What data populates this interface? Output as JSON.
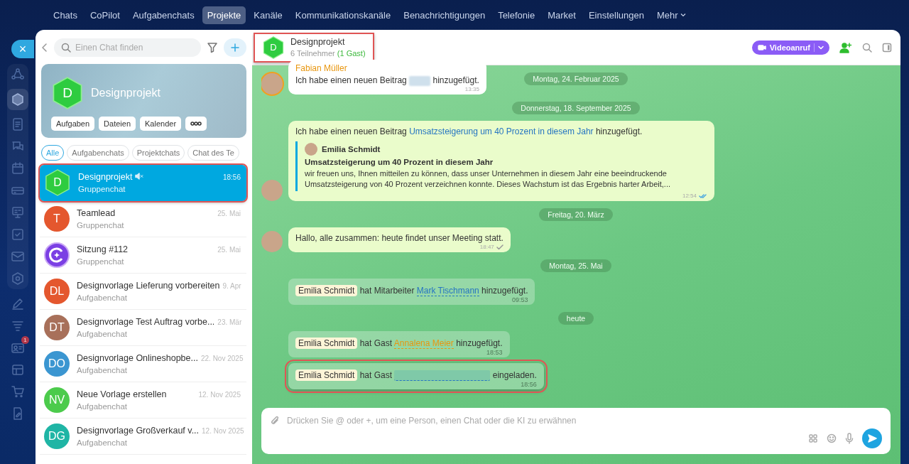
{
  "topnav": {
    "items": [
      {
        "label": "Chats",
        "selected": false
      },
      {
        "label": "CoPilot",
        "selected": false
      },
      {
        "label": "Aufgabenchats",
        "selected": false
      },
      {
        "label": "Projekte",
        "selected": true
      },
      {
        "label": "Kanäle",
        "selected": false
      },
      {
        "label": "Kommunikationskanäle",
        "selected": false
      },
      {
        "label": "Benachrichtigungen",
        "selected": false
      },
      {
        "label": "Telefonie",
        "selected": false
      },
      {
        "label": "Market",
        "selected": false
      },
      {
        "label": "Einstellungen",
        "selected": false
      }
    ],
    "more": "Mehr"
  },
  "rail": {
    "close": "×",
    "badge": "1"
  },
  "sidebar": {
    "search": {
      "placeholder": "Einen Chat finden"
    },
    "project": {
      "initial": "D",
      "title": "Designprojekt",
      "buttons": [
        "Aufgaben",
        "Dateien",
        "Kalender"
      ]
    },
    "filters": [
      {
        "label": "Alle",
        "selected": true
      },
      {
        "label": "Aufgabenchats",
        "selected": false
      },
      {
        "label": "Projektchats",
        "selected": false
      },
      {
        "label": "Chat des Te",
        "selected": false
      }
    ],
    "chats": [
      {
        "kind": "hexagon",
        "initials": "D",
        "color": "#2ecc40",
        "title": "Designprojekt",
        "subtitle": "Gruppenchat",
        "time": "18:56",
        "muted": true,
        "selected": true,
        "highlighted": true
      },
      {
        "kind": "letters",
        "initials": "T",
        "color": "#e4572e",
        "title": "Teamlead",
        "subtitle": "Gruppenchat",
        "time": "25. Mai",
        "muted": false,
        "selected": false,
        "highlighted": false
      },
      {
        "kind": "logo",
        "color": "#7b3fe4",
        "title": "Sitzung #112",
        "subtitle": "Gruppenchat",
        "time": "25. Mai",
        "muted": false,
        "selected": false,
        "highlighted": false
      },
      {
        "kind": "letters",
        "initials": "DL",
        "color": "#e4572e",
        "title": "Designvorlage Lieferung vorbereiten",
        "subtitle": "Aufgabenchat",
        "time": "9. Apr",
        "muted": false,
        "selected": false,
        "highlighted": false
      },
      {
        "kind": "letters",
        "initials": "DT",
        "color": "#a8705a",
        "title": "Designvorlage Test Auftrag vorbe...",
        "subtitle": "Aufgabenchat",
        "time": "23. Mär",
        "muted": false,
        "selected": false,
        "highlighted": false
      },
      {
        "kind": "letters",
        "initials": "DO",
        "color": "#3b96d1",
        "title": "Designvorlage Onlineshopbe...",
        "subtitle": "Aufgabenchat",
        "time": "22. Nov 2025",
        "muted": false,
        "selected": false,
        "highlighted": false
      },
      {
        "kind": "letters",
        "initials": "NV",
        "color": "#4ccb4c",
        "title": "Neue Vorlage erstellen",
        "subtitle": "Aufgabenchat",
        "time": "12. Nov 2025",
        "muted": false,
        "selected": false,
        "highlighted": false
      },
      {
        "kind": "letters",
        "initials": "DG",
        "color": "#1fb5a5",
        "title": "Designvorlage Großverkauf v...",
        "subtitle": "Aufgabenchat",
        "time": "12. Nov 2025",
        "muted": false,
        "selected": false,
        "highlighted": false
      }
    ]
  },
  "header": {
    "initial": "D",
    "title": "Designprojekt",
    "members": "6 Teilnehmer",
    "guests": "(1 Gast)",
    "highlighted": true,
    "video_button": "Videoanruf"
  },
  "messages": [
    {
      "kind": "message",
      "own": false,
      "avatar": true,
      "author": "Fabian Müller",
      "parts": [
        {
          "kind": "text",
          "text": "Ich habe einen neuen Beitrag "
        },
        {
          "kind": "redacted"
        },
        {
          "kind": "text",
          "text": " hinzugefügt."
        }
      ],
      "time": "13:35",
      "beside": "Montag, 24. Februar 2025"
    },
    {
      "kind": "date",
      "text": "Donnerstag, 18. September 2025"
    },
    {
      "kind": "message",
      "own": true,
      "avatar": true,
      "parts": [
        {
          "kind": "text",
          "text": "Ich habe einen neuen Beitrag "
        },
        {
          "kind": "link",
          "text": "Umsatzsteigerung um 40 Prozent in diesem Jahr"
        },
        {
          "kind": "text",
          "text": " hinzugefügt."
        }
      ],
      "quote": {
        "author": "Emilia Schmidt",
        "title": "Umsatzsteigerung um 40 Prozent in diesem Jahr",
        "body": "wir freuen uns, Ihnen mitteilen zu können, dass unser Unternehmen in diesem Jahr eine beeindruckende Umsatzsteigerung von 40 Prozent verzeichnen konnte. Dieses Wachstum ist das Ergebnis harter Arbeit,..."
      },
      "time": "12:54",
      "read": true
    },
    {
      "kind": "date",
      "text": "Freitag, 20. März"
    },
    {
      "kind": "message",
      "own": true,
      "avatar": true,
      "parts": [
        {
          "kind": "text",
          "text": "Hallo, alle zusammen: heute findet unser Meeting statt."
        }
      ],
      "time": "18:47",
      "read": false
    },
    {
      "kind": "date",
      "text": "Montag, 25. Mai"
    },
    {
      "kind": "system",
      "parts": [
        {
          "kind": "mention",
          "text": "Emilia Schmidt"
        },
        {
          "kind": "text",
          "text": " hat Mitarbeiter "
        },
        {
          "kind": "user",
          "text": "Mark Tischmann"
        },
        {
          "kind": "text",
          "text": " hinzugefügt."
        }
      ],
      "time": "09:53",
      "highlighted": false
    },
    {
      "kind": "date",
      "text": "heute"
    },
    {
      "kind": "system",
      "parts": [
        {
          "kind": "mention",
          "text": "Emilia Schmidt"
        },
        {
          "kind": "text",
          "text": " hat Gast "
        },
        {
          "kind": "guest",
          "text": "Annalena Meier"
        },
        {
          "kind": "text",
          "text": " hinzugefügt."
        }
      ],
      "time": "18:53",
      "highlighted": false
    },
    {
      "kind": "system",
      "parts": [
        {
          "kind": "mention",
          "text": "Emilia Schmidt"
        },
        {
          "kind": "text",
          "text": " hat Gast "
        },
        {
          "kind": "redacted_user"
        },
        {
          "kind": "text",
          "text": " eingeladen."
        }
      ],
      "time": "18:56",
      "highlighted": true
    }
  ],
  "composer": {
    "placeholder": "Drücken Sie @ oder +, um eine Person, einen Chat oder die KI zu erwähnen"
  }
}
